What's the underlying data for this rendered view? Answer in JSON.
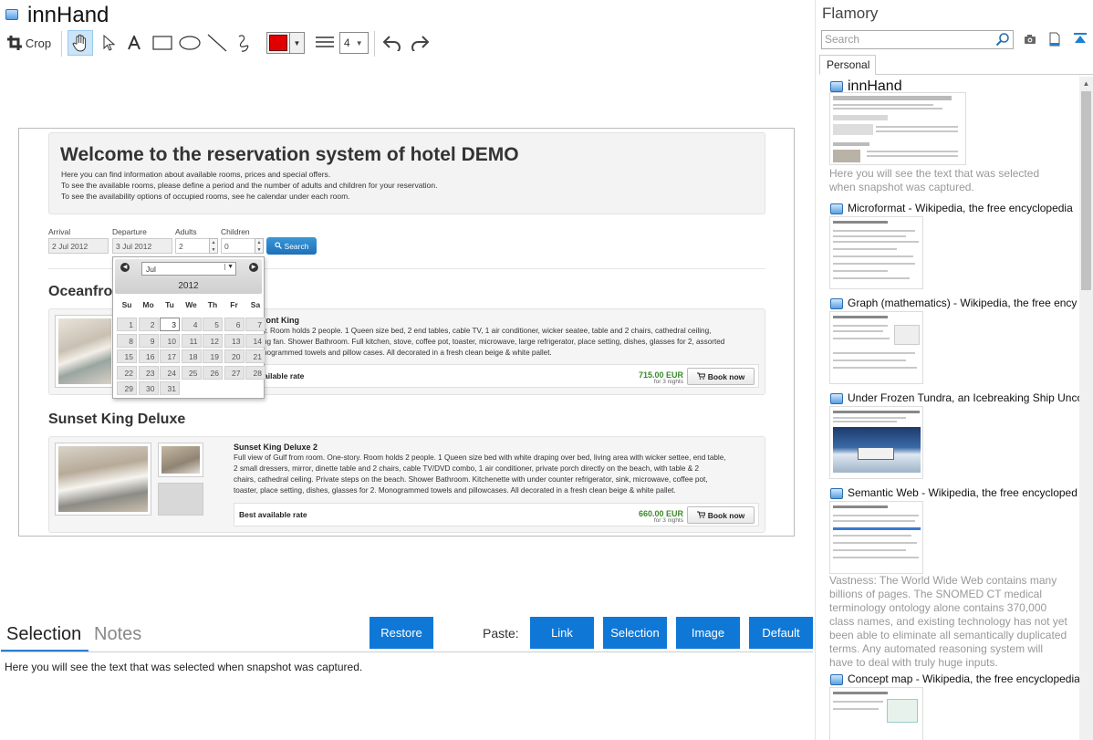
{
  "app": {
    "title": "innHand"
  },
  "toolbar": {
    "crop_label": "Crop",
    "line_width": "4"
  },
  "hotel": {
    "title": "Welcome to the reservation system of hotel DEMO",
    "intro": [
      "Here you can find information about available rooms, prices and special offers.",
      "To see the available rooms, please define a period and the number of adults and children for your reservation.",
      "To see the availability options of occupied rooms, see he calendar under each room."
    ],
    "form": {
      "arrival_label": "Arrival",
      "arrival_value": "2 Jul 2012",
      "departure_label": "Departure",
      "departure_value": "3 Jul 2012",
      "adults_label": "Adults",
      "adults_value": "2",
      "children_label": "Children",
      "children_value": "0",
      "search_label": "Search"
    },
    "datepicker": {
      "month": "Jul",
      "year": "2012",
      "weekdays": [
        "Su",
        "Mo",
        "Tu",
        "We",
        "Th",
        "Fr",
        "Sa"
      ],
      "days": [
        "1",
        "2",
        "3",
        "4",
        "5",
        "6",
        "7",
        "8",
        "9",
        "10",
        "11",
        "12",
        "13",
        "14",
        "15",
        "16",
        "17",
        "18",
        "19",
        "20",
        "21",
        "22",
        "23",
        "24",
        "25",
        "26",
        "27",
        "28",
        "29",
        "30",
        "31"
      ]
    },
    "section1": {
      "title_visible": "Oceanfro",
      "room_name_visible": "ront King",
      "desc": [
        "y. Room holds 2 people. 1 Queen size bed, 2 end tables, cable TV, 1 air conditioner, wicker seatee, table and 2 chairs, cathedral ceiling,",
        "ng fan. Shower Bathroom. Full kitchen, stove, coffee pot, toaster, microwave, large refrigerator, place setting, dishes, glasses for 2, assorted",
        "nogrammed towels and pillow cases. All decorated in a fresh clean beige & white pallet."
      ],
      "rate_visible": "ailable rate",
      "price": "715.00 EUR",
      "nights": "for 3 nights",
      "book": "Book now"
    },
    "section2": {
      "title": "Sunset King Deluxe",
      "room_name": "Sunset King Deluxe 2",
      "desc": [
        "Full view of Gulf from room. One-story. Room holds 2 people. 1 Queen size bed with white draping over bed, living area with wicker settee, end table,",
        "2 small dressers, mirror, dinette table and 2 chairs, cable TV/DVD combo, 1 air conditioner, private porch directly on the beach, with table & 2",
        "chairs, cathedral ceiling. Private steps on the beach. Shower Bathroom. Kitchenette with under counter refrigerator, sink, microwave, coffee pot,",
        "toaster, place setting, dishes, glasses for 2. Monogrammed towels and pillowcases. All decorated in a fresh clean beige & white pallet."
      ],
      "rate": "Best available rate",
      "price": "660.00 EUR",
      "nights": "for 3 nights",
      "book": "Book now"
    }
  },
  "bottom": {
    "tabs": [
      "Selection",
      "Notes"
    ],
    "restore": "Restore",
    "paste_label": "Paste:",
    "paste_buttons": [
      "Link",
      "Selection",
      "Image",
      "Default"
    ],
    "selection_text": "Here you will see the text that was selected when snapshot was captured."
  },
  "panel": {
    "title": "Flamory",
    "search_placeholder": "Search",
    "tab": "Personal",
    "entries": [
      {
        "title": "innHand",
        "snippet": "Here you will see the text that was selected when snapshot was captured."
      },
      {
        "title": "Microformat - Wikipedia, the free encyclopedia"
      },
      {
        "title": "Graph (mathematics) - Wikipedia, the free ency"
      },
      {
        "title": "Under Frozen Tundra, an Icebreaking Ship Unco"
      },
      {
        "title": "Semantic Web - Wikipedia, the free encycloped",
        "snippet": "Vastness: The World Wide Web contains many billions of pages. The SNOMED CT medical terminology ontology alone contains 370,000 class names, and existing technology has not yet been able to eliminate all semantically duplicated terms. Any automated reasoning system will have to deal with truly huge inputs."
      },
      {
        "title": "Concept map - Wikipedia, the free encyclopedia"
      }
    ]
  },
  "colors": {
    "accent": "#0f78d7",
    "pen": "#e00000",
    "price": "#3a8a2a"
  }
}
